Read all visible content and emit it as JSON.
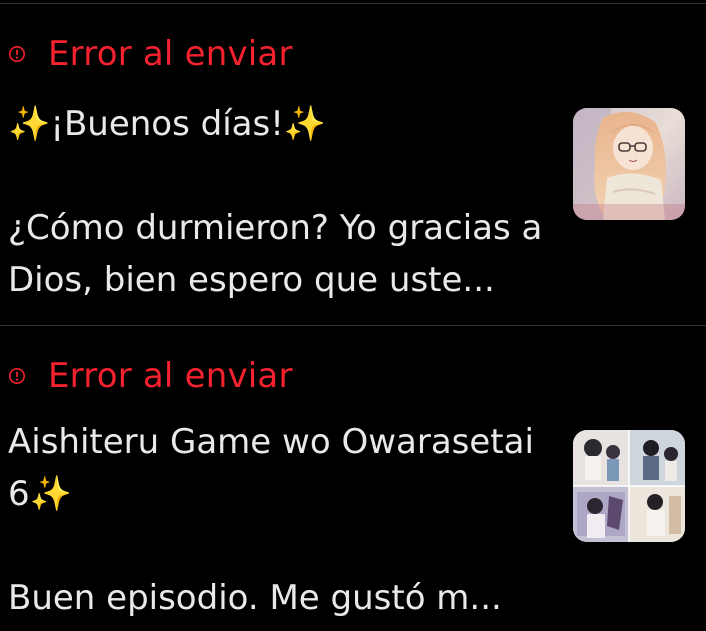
{
  "items": [
    {
      "status": "Error al enviar",
      "text": "✨¡Buenos días!✨\n\n¿Cómo durmieron? Yo gracias a Dios, bien espero que uste...",
      "thumbnail_icon": "anime-girl-glasses-thumbnail"
    },
    {
      "status": "Error al enviar",
      "text": "Aishiteru Game wo Owarasetai 6✨\n\nBuen episodio. Me gustó m...",
      "thumbnail_icon": "anime-collage-thumbnail"
    }
  ],
  "colors": {
    "background": "#000000",
    "error": "#f4212e",
    "text": "#e7e9ea",
    "divider": "#2f3336"
  }
}
